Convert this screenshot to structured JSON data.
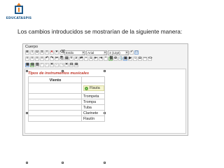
{
  "logo": {
    "text": "EDUCATASPIS"
  },
  "caption": "Los cambios introducidos se mostrarían de la siguiente manera:",
  "editor": {
    "title": "Cuerpo",
    "font_style": "Estilo",
    "font_family": "Arial",
    "font_size": "3 (12pt)"
  },
  "table": {
    "caption": "Tipos de instrumentos musicales",
    "header": "Viento",
    "highlight": "Flauta",
    "rows": [
      "Trompeta",
      "Trompa",
      "Tuba",
      "Clarinete",
      "Flautín"
    ]
  },
  "colors": {
    "caption_red": "#c0392b",
    "highlight_bg": "#f5f5d0",
    "accent_green": "#5aa83a"
  }
}
